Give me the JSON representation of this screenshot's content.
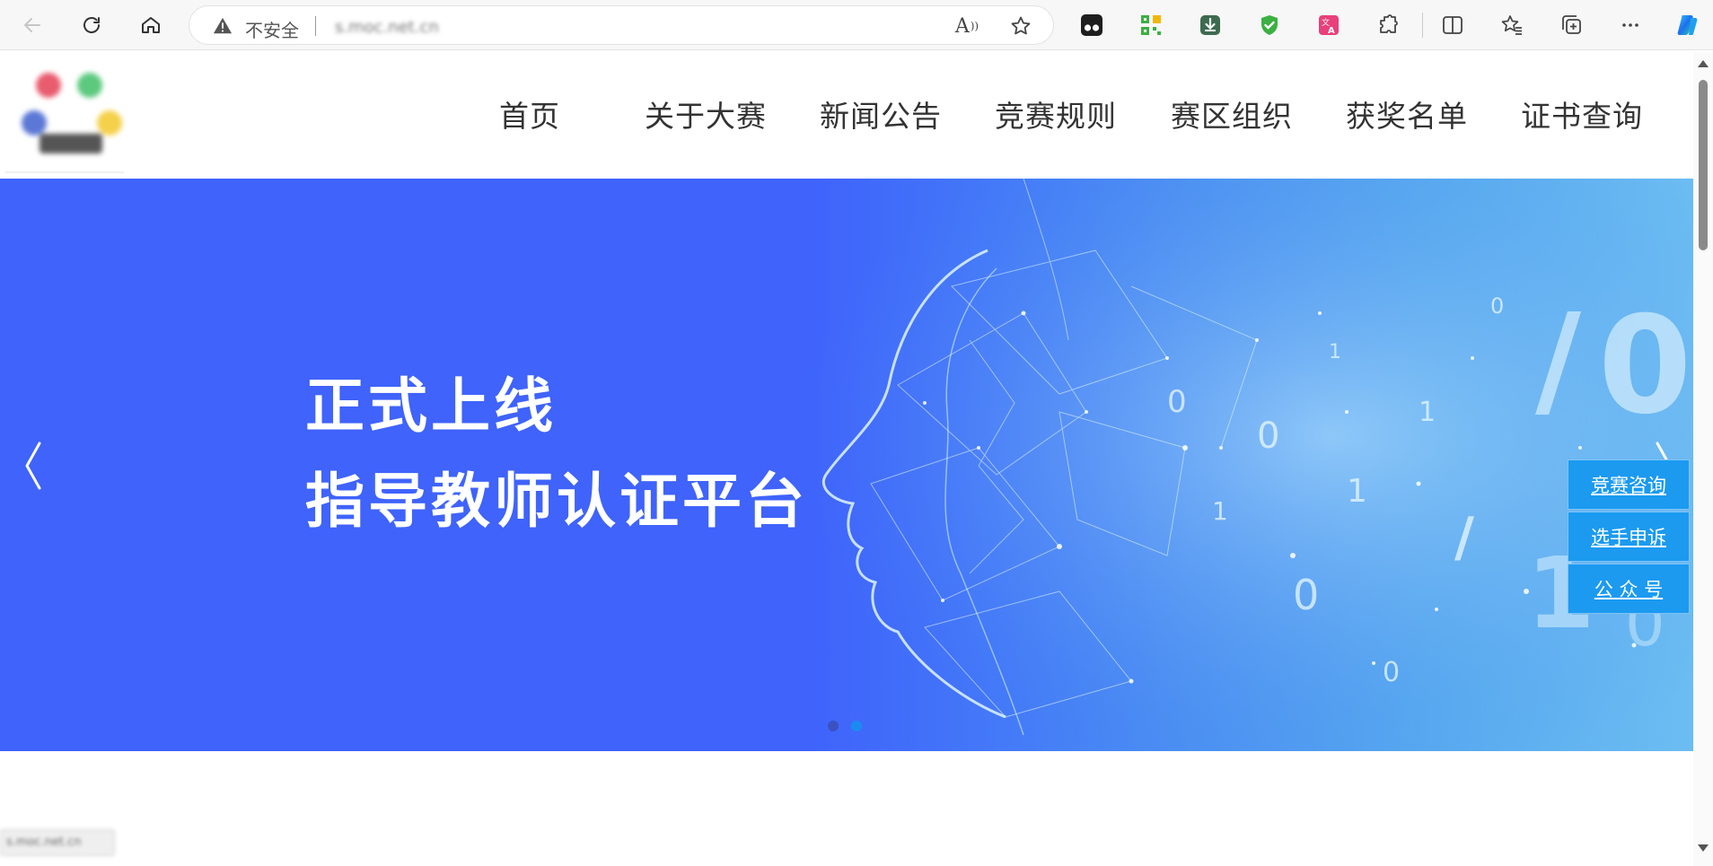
{
  "browser": {
    "security_label": "不安全",
    "url": "s.moc.net.cn",
    "extensions": [
      "tampermonkey-icon",
      "qr-code-icon",
      "download-manager-icon",
      "shield-check-icon",
      "translate-icon"
    ],
    "toolbar_icons": [
      "puzzle-icon",
      "split-screen-icon",
      "favorites-icon",
      "collections-icon",
      "more-icon",
      "copilot-icon"
    ]
  },
  "header": {
    "nav": [
      {
        "label": "首页"
      },
      {
        "label": "关于大赛"
      },
      {
        "label": "新闻公告"
      },
      {
        "label": "竞赛规则"
      },
      {
        "label": "赛区组织"
      },
      {
        "label": "获奖名单"
      },
      {
        "label": "证书查询"
      }
    ]
  },
  "banner": {
    "title_line1": "正式上线",
    "title_line2": "指导教师认证平台",
    "slide_count": 2,
    "active_slide": 2,
    "background": "#3f63fb"
  },
  "float_panel": {
    "buttons": [
      {
        "label": "竞赛咨询"
      },
      {
        "label": "选手申诉"
      },
      {
        "label": "公 众 号"
      }
    ],
    "color": "#1b9af0"
  },
  "status_bar": {
    "url": "s.moc.net.cn"
  }
}
